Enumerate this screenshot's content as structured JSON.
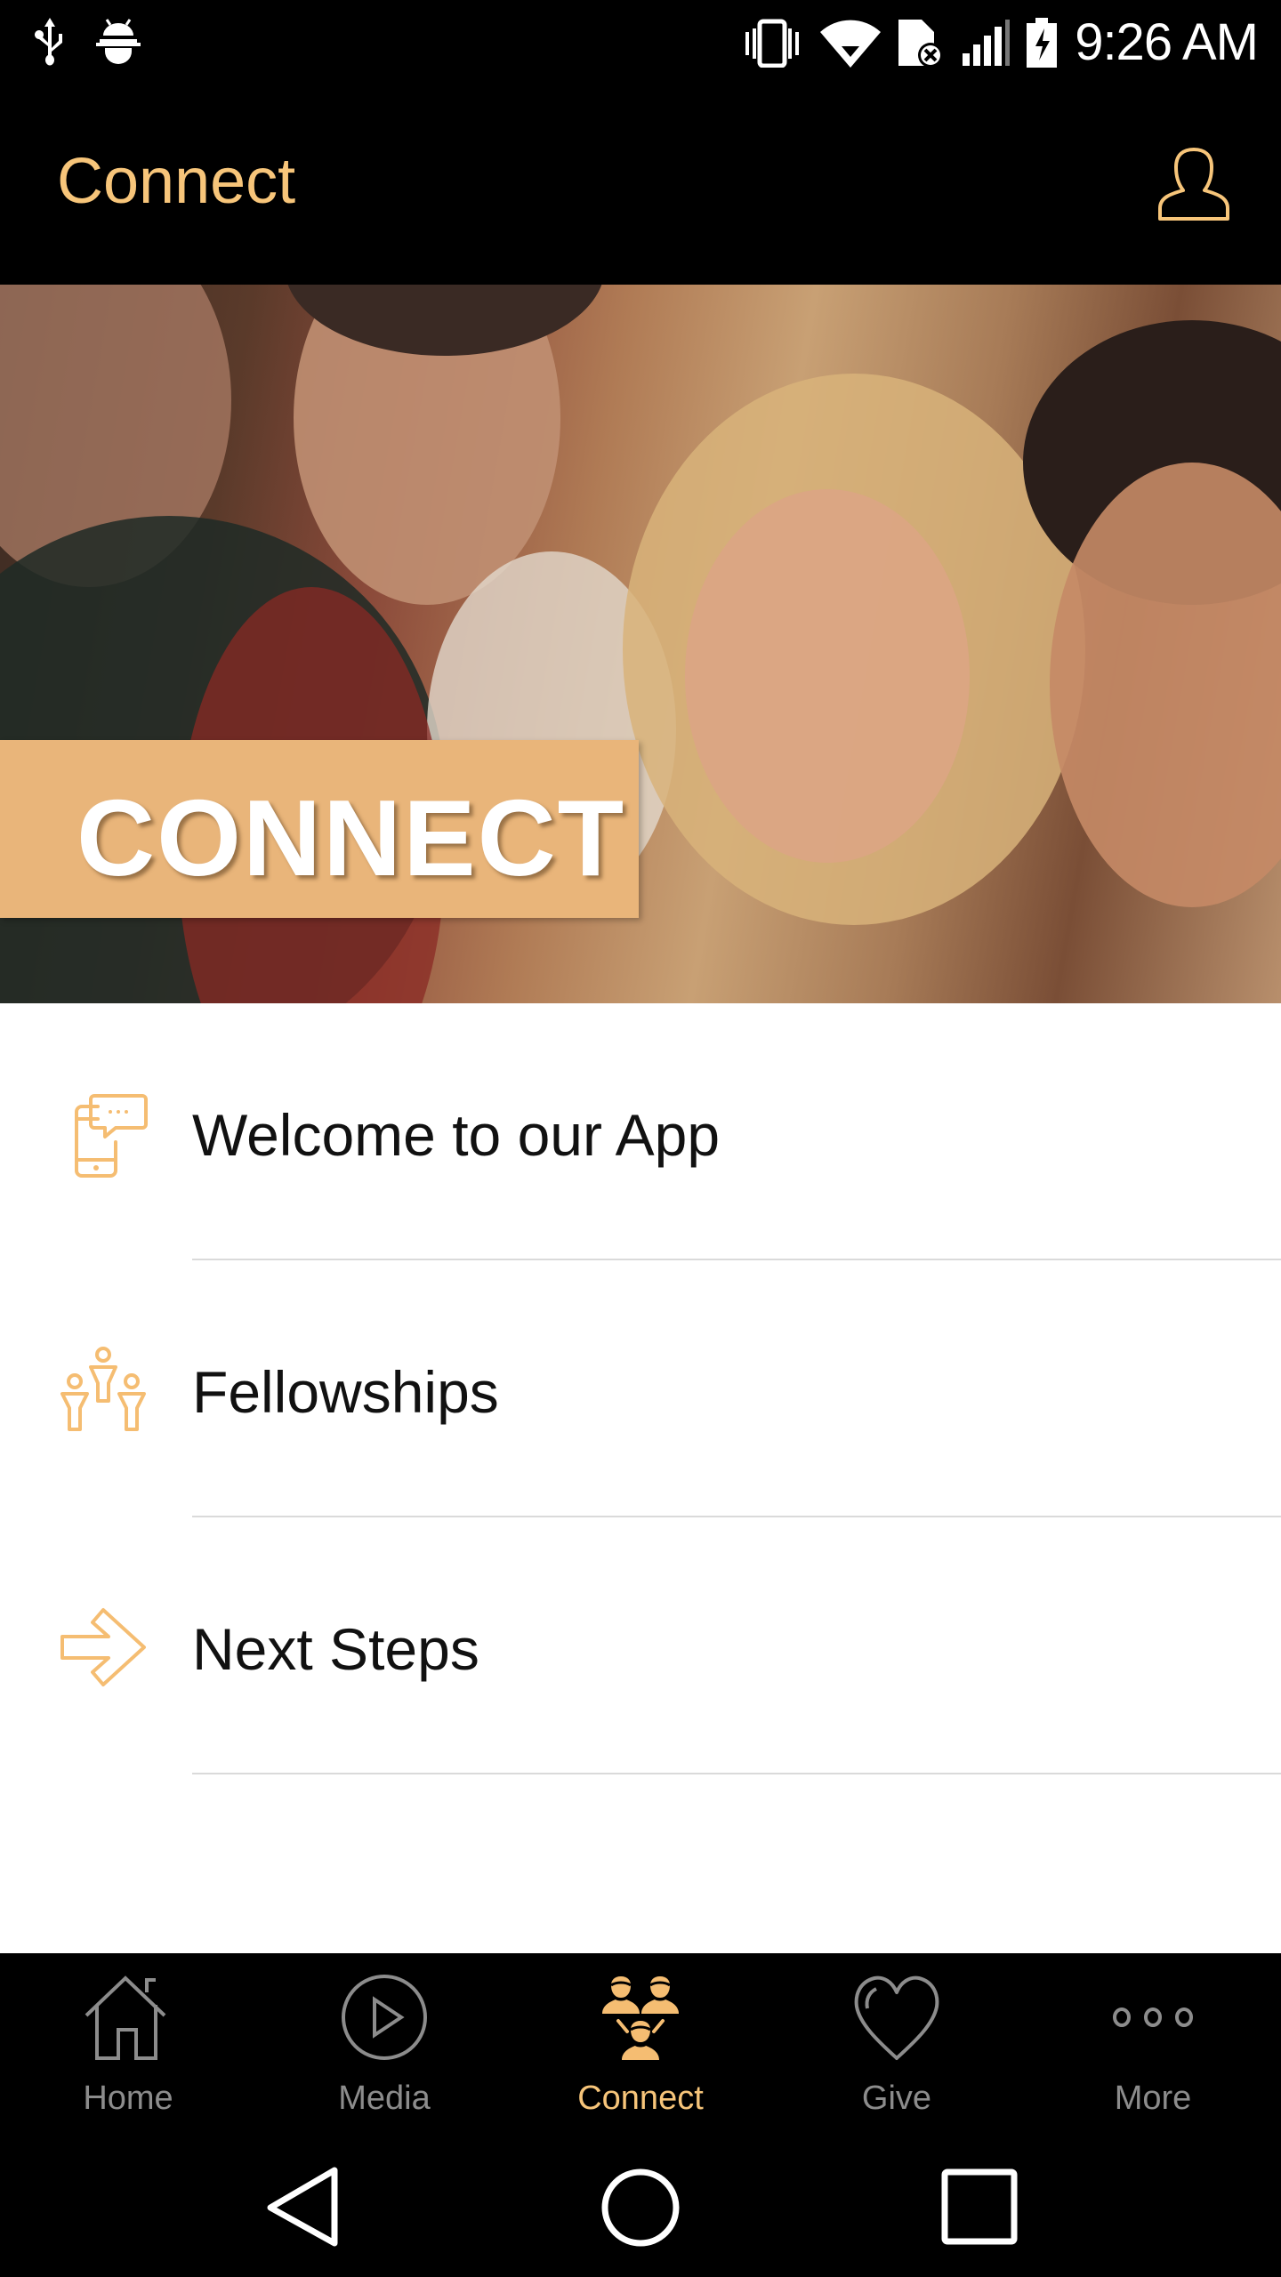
{
  "status_bar": {
    "time": "9:26 AM",
    "left_icons": [
      "usb-icon",
      "android-debug-icon"
    ],
    "right_icons": [
      "vibrate-icon",
      "wifi-icon",
      "sim-error-icon",
      "signal-icon",
      "battery-charging-icon"
    ]
  },
  "app_bar": {
    "title": "Connect",
    "profile_icon": "user-profile-icon"
  },
  "hero": {
    "banner_text": "CONNECT",
    "image_description": "Group of smiling people"
  },
  "list": {
    "items": [
      {
        "label": "Welcome to our App",
        "icon": "phone-chat-icon"
      },
      {
        "label": "Fellowships",
        "icon": "group-people-icon"
      },
      {
        "label": "Next Steps",
        "icon": "arrow-right-icon"
      }
    ]
  },
  "tab_bar": {
    "tabs": [
      {
        "label": "Home",
        "icon": "home-icon",
        "active": false
      },
      {
        "label": "Media",
        "icon": "play-circle-icon",
        "active": false
      },
      {
        "label": "Connect",
        "icon": "connect-people-icon",
        "active": true
      },
      {
        "label": "Give",
        "icon": "heart-icon",
        "active": false
      },
      {
        "label": "More",
        "icon": "more-dots-icon",
        "active": false
      }
    ]
  },
  "colors": {
    "accent": "#f7c57a",
    "banner": "#e9b57a",
    "inactive_tab": "#8c8c8c",
    "background_dark": "#000000",
    "list_background": "#ffffff",
    "divider": "#dadada"
  }
}
